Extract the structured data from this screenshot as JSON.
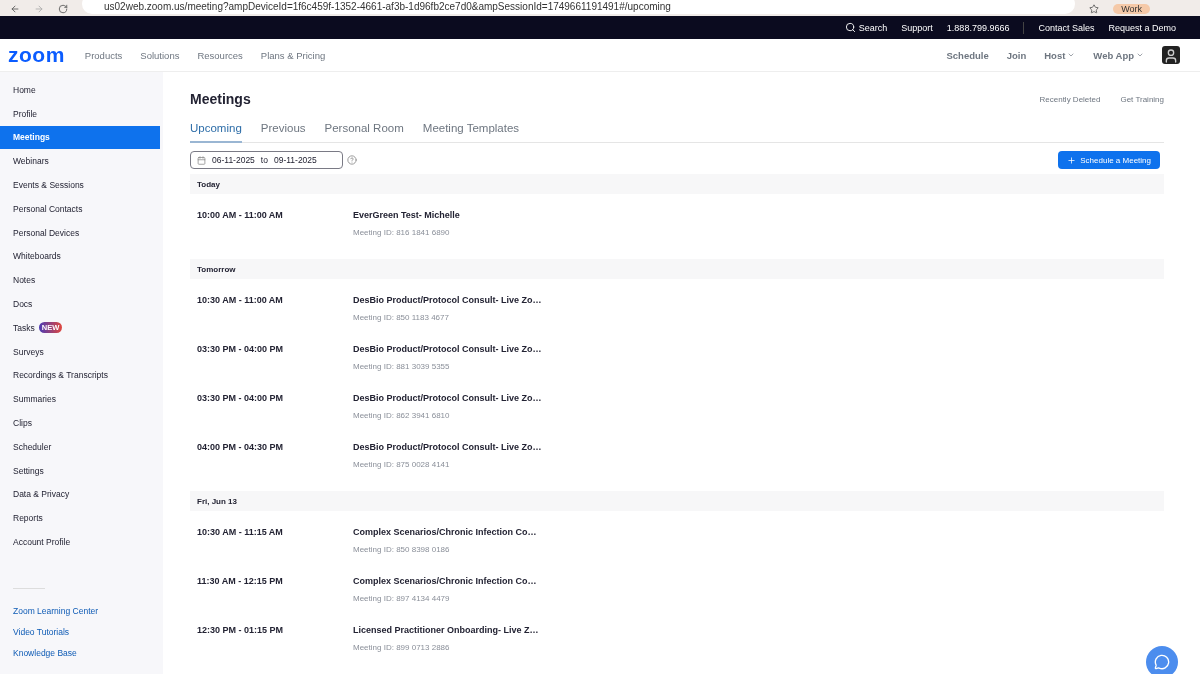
{
  "browser": {
    "url": "us02web.zoom.us/meeting?ampDeviceId=1f6c459f-1352-4661-af3b-1d96fb2ce7d0&ampSessionId=1749661191491#/upcoming",
    "profile": "Work"
  },
  "top_bar": {
    "search": "Search",
    "links": [
      "Support",
      "1.888.799.9666"
    ],
    "sales_links": [
      "Contact Sales",
      "Request a Demo"
    ]
  },
  "nav": {
    "logo": "zoom",
    "menu": [
      "Products",
      "Solutions",
      "Resources",
      "Plans & Pricing"
    ],
    "right": [
      {
        "label": "Schedule",
        "dropdown": false
      },
      {
        "label": "Join",
        "dropdown": false
      },
      {
        "label": "Host",
        "dropdown": true
      },
      {
        "label": "Web App",
        "dropdown": true
      }
    ]
  },
  "sidebar": {
    "items": [
      {
        "label": "Home",
        "selected": false
      },
      {
        "label": "Profile",
        "selected": false
      },
      {
        "label": "Meetings",
        "selected": true
      },
      {
        "label": "Webinars",
        "selected": false
      },
      {
        "label": "Events & Sessions",
        "selected": false
      },
      {
        "label": "Personal Contacts",
        "selected": false
      },
      {
        "label": "Personal Devices",
        "selected": false
      },
      {
        "label": "Whiteboards",
        "selected": false
      },
      {
        "label": "Notes",
        "selected": false
      },
      {
        "label": "Docs",
        "selected": false
      },
      {
        "label": "Tasks",
        "selected": false,
        "badge": "NEW"
      },
      {
        "label": "Surveys",
        "selected": false
      },
      {
        "label": "Recordings & Transcripts",
        "selected": false
      },
      {
        "label": "Summaries",
        "selected": false
      },
      {
        "label": "Clips",
        "selected": false
      },
      {
        "label": "Scheduler",
        "selected": false
      },
      {
        "label": "Settings",
        "selected": false
      },
      {
        "label": "Data & Privacy",
        "selected": false
      },
      {
        "label": "Reports",
        "selected": false
      },
      {
        "label": "Account Profile",
        "selected": false
      }
    ],
    "links": [
      "Zoom Learning Center",
      "Video Tutorials",
      "Knowledge Base"
    ]
  },
  "page": {
    "title": "Meetings",
    "actions": [
      "Recently Deleted",
      "Get Training"
    ],
    "tabs": [
      {
        "label": "Upcoming",
        "selected": true
      },
      {
        "label": "Previous",
        "selected": false
      },
      {
        "label": "Personal Room",
        "selected": false
      },
      {
        "label": "Meeting Templates",
        "selected": false
      }
    ],
    "date_range": {
      "from": "06-11-2025",
      "separator": "to",
      "to": "09-11-2025"
    },
    "schedule_button": "Schedule a Meeting",
    "groups": [
      {
        "label": "Today",
        "meetings": [
          {
            "time": "10:00 AM - 11:00 AM",
            "title": "EverGreen Test- Michelle",
            "meeting_id": "Meeting ID: 816 1841 6890"
          }
        ]
      },
      {
        "label": "Tomorrow",
        "meetings": [
          {
            "time": "10:30 AM - 11:00 AM",
            "title": "DesBio Product/Protocol Consult- Live Zo…",
            "meeting_id": "Meeting ID: 850 1183 4677"
          },
          {
            "time": "03:30 PM - 04:00 PM",
            "title": "DesBio Product/Protocol Consult- Live Zo…",
            "meeting_id": "Meeting ID: 881 3039 5355"
          },
          {
            "time": "03:30 PM - 04:00 PM",
            "title": "DesBio Product/Protocol Consult- Live Zo…",
            "meeting_id": "Meeting ID: 862 3941 6810"
          },
          {
            "time": "04:00 PM - 04:30 PM",
            "title": "DesBio Product/Protocol Consult- Live Zo…",
            "meeting_id": "Meeting ID: 875 0028 4141"
          }
        ]
      },
      {
        "label": "Fri, Jun 13",
        "meetings": [
          {
            "time": "10:30 AM - 11:15 AM",
            "title": "Complex Scenarios/Chronic Infection Co…",
            "meeting_id": "Meeting ID: 850 8398 0186"
          },
          {
            "time": "11:30 AM - 12:15 PM",
            "title": "Complex Scenarios/Chronic Infection Co…",
            "meeting_id": "Meeting ID: 897 4134 4479"
          },
          {
            "time": "12:30 PM - 01:15 PM",
            "title": "Licensed Practitioner Onboarding- Live Z…",
            "meeting_id": "Meeting ID: 899 0713 2886"
          }
        ]
      }
    ]
  }
}
